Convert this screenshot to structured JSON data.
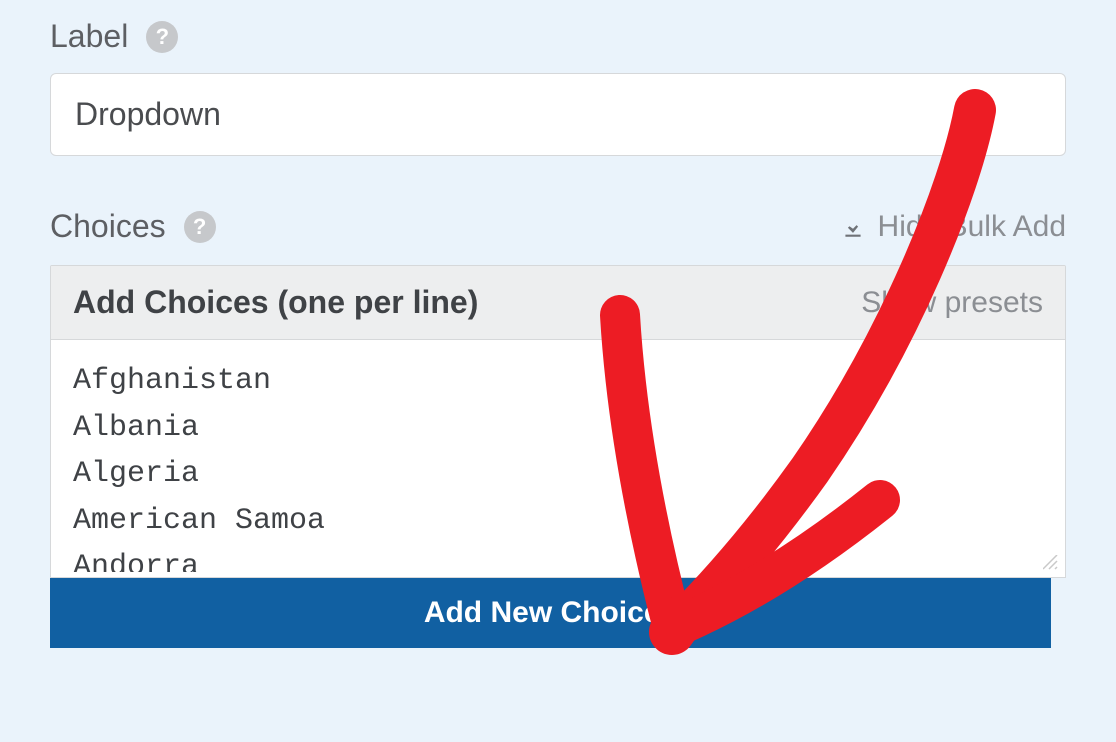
{
  "label_field": {
    "title": "Label",
    "value": "Dropdown"
  },
  "choices_field": {
    "title": "Choices",
    "bulk_toggle": "Hide Bulk Add",
    "panel_title": "Add Choices (one per line)",
    "show_presets": "Show presets",
    "textarea_value": "Afghanistan\nAlbania\nAlgeria\nAmerican Samoa\nAndorra",
    "submit_label": "Add New Choices"
  }
}
